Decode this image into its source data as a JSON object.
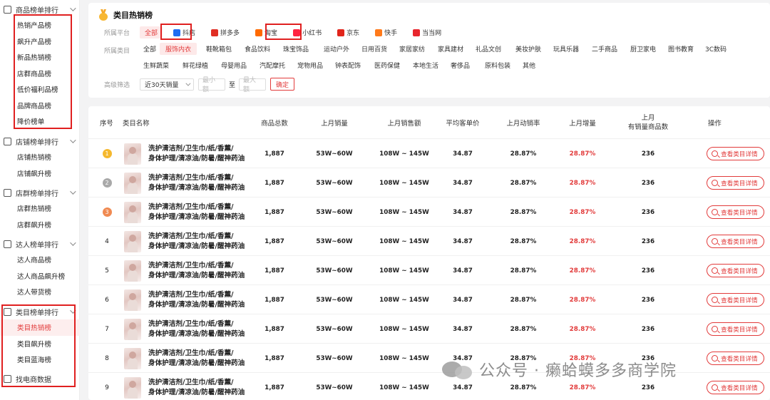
{
  "sidebar": {
    "groups": [
      {
        "title": "商品榜单排行",
        "items": [
          "热销产品榜",
          "飙升产品榜",
          "新品热销榜",
          "店群商品榜",
          "低价福利品榜",
          "品牌商品榜",
          "降价榜单"
        ]
      },
      {
        "title": "店铺榜单排行",
        "items": [
          "店铺热销榜",
          "店铺飙升榜"
        ]
      },
      {
        "title": "店群榜单排行",
        "items": [
          "店群热销榜",
          "店群飙升榜"
        ]
      },
      {
        "title": "达人榜单排行",
        "items": [
          "达人商品榜",
          "达人商品飙升榜",
          "达人带货榜"
        ]
      },
      {
        "title": "类目榜单排行",
        "items": [
          "类目热销榜",
          "类目飙升榜",
          "类目蓝海榜"
        ]
      }
    ],
    "extra": "找电商数据",
    "active_item": "类目热销榜"
  },
  "header": {
    "title": "类目热销榜"
  },
  "filters": {
    "platform_label": "所属平台",
    "platforms": [
      {
        "label": "全部",
        "selected": true,
        "color": ""
      },
      {
        "label": "抖店",
        "selected": false,
        "color": "#1f6df2"
      },
      {
        "label": "拼多多",
        "selected": false,
        "color": "#e02e24"
      },
      {
        "label": "淘宝",
        "selected": false,
        "color": "#ff6a00"
      },
      {
        "label": "小红书",
        "selected": false,
        "color": "#ff2442"
      },
      {
        "label": "京东",
        "selected": false,
        "color": "#e1251b"
      },
      {
        "label": "快手",
        "selected": false,
        "color": "#ff7a1a"
      },
      {
        "label": "当当网",
        "selected": false,
        "color": "#e8262d"
      }
    ],
    "category_label": "所属类目",
    "categories_row1": [
      "全部",
      "服饰内衣",
      "鞋靴箱包",
      "食品饮料",
      "珠宝饰品",
      "运动户外",
      "日用百货",
      "家居家纺",
      "家具建材",
      "礼品文创",
      "美妆护肤",
      "玩具乐器",
      "二手商品",
      "厨卫家电",
      "图书教育",
      "3C数码"
    ],
    "categories_row2": [
      "生鲜蔬菜",
      "鲜花绿植",
      "母婴用品",
      "汽配摩托",
      "宠物用品",
      "钟表配饰",
      "医药保健",
      "本地生活",
      "奢侈品",
      "原料包装",
      "其他"
    ],
    "selected_category": "服饰内衣",
    "advanced_label": "高级筛选",
    "period_value": "近30天销量",
    "min_placeholder": "最小额",
    "to_label": "至",
    "max_placeholder": "最大额",
    "confirm_label": "确定"
  },
  "table": {
    "headers": {
      "rank": "序号",
      "name": "类目名称",
      "total": "商品总数",
      "sales": "上月销量",
      "revenue": "上月销售额",
      "avg_price": "平均客单价",
      "move_rate": "上月动销率",
      "growth": "上月增量",
      "with_sales_line1": "上月",
      "with_sales_line2": "有销量商品数",
      "action": "操作"
    },
    "rows": [
      {
        "rank": "1",
        "name_line1": "洗护清洁剂/卫生巾/纸/香薰/",
        "name_line2": "身体护理/清凉油/防暑/醒神药油",
        "total": "1,887",
        "sales": "53W~60W",
        "revenue": "108W ~ 145W",
        "avg_price": "34.87",
        "move_rate": "28.87%",
        "growth": "28.87%",
        "with_sales": "236",
        "action": "查看类目详情"
      },
      {
        "rank": "2",
        "name_line1": "洗护清洁剂/卫生巾/纸/香薰/",
        "name_line2": "身体护理/清凉油/防暑/醒神药油",
        "total": "1,887",
        "sales": "53W~60W",
        "revenue": "108W ~ 145W",
        "avg_price": "34.87",
        "move_rate": "28.87%",
        "growth": "28.87%",
        "with_sales": "236",
        "action": "查看类目详情"
      },
      {
        "rank": "3",
        "name_line1": "洗护清洁剂/卫生巾/纸/香薰/",
        "name_line2": "身体护理/清凉油/防暑/醒神药油",
        "total": "1,887",
        "sales": "53W~60W",
        "revenue": "108W ~ 145W",
        "avg_price": "34.87",
        "move_rate": "28.87%",
        "growth": "28.87%",
        "with_sales": "236",
        "action": "查看类目详情"
      },
      {
        "rank": "4",
        "name_line1": "洗护清洁剂/卫生巾/纸/香薰/",
        "name_line2": "身体护理/清凉油/防暑/醒神药油",
        "total": "1,887",
        "sales": "53W~60W",
        "revenue": "108W ~ 145W",
        "avg_price": "34.87",
        "move_rate": "28.87%",
        "growth": "28.87%",
        "with_sales": "236",
        "action": "查看类目详情"
      },
      {
        "rank": "5",
        "name_line1": "洗护清洁剂/卫生巾/纸/香薰/",
        "name_line2": "身体护理/清凉油/防暑/醒神药油",
        "total": "1,887",
        "sales": "53W~60W",
        "revenue": "108W ~ 145W",
        "avg_price": "34.87",
        "move_rate": "28.87%",
        "growth": "28.87%",
        "with_sales": "236",
        "action": "查看类目详情"
      },
      {
        "rank": "6",
        "name_line1": "洗护清洁剂/卫生巾/纸/香薰/",
        "name_line2": "身体护理/清凉油/防暑/醒神药油",
        "total": "1,887",
        "sales": "53W~60W",
        "revenue": "108W ~ 145W",
        "avg_price": "34.87",
        "move_rate": "28.87%",
        "growth": "28.87%",
        "with_sales": "236",
        "action": "查看类目详情"
      },
      {
        "rank": "7",
        "name_line1": "洗护清洁剂/卫生巾/纸/香薰/",
        "name_line2": "身体护理/清凉油/防暑/醒神药油",
        "total": "1,887",
        "sales": "53W~60W",
        "revenue": "108W ~ 145W",
        "avg_price": "34.87",
        "move_rate": "28.87%",
        "growth": "28.87%",
        "with_sales": "236",
        "action": "查看类目详情"
      },
      {
        "rank": "8",
        "name_line1": "洗护清洁剂/卫生巾/纸/香薰/",
        "name_line2": "身体护理/清凉油/防暑/醒神药油",
        "total": "1,887",
        "sales": "53W~60W",
        "revenue": "108W ~ 145W",
        "avg_price": "34.87",
        "move_rate": "28.87%",
        "growth": "28.87%",
        "with_sales": "236",
        "action": "查看类目详情"
      },
      {
        "rank": "9",
        "name_line1": "洗护清洁剂/卫生巾/纸/香薰/",
        "name_line2": "身体护理/清凉油/防暑/醒神药油",
        "total": "1,887",
        "sales": "53W~60W",
        "revenue": "108W ~ 145W",
        "avg_price": "34.87",
        "move_rate": "28.87%",
        "growth": "28.87%",
        "with_sales": "236",
        "action": "查看类目详情"
      }
    ],
    "rank_colors": [
      "#f5b82e",
      "#a9a9a9",
      "#f08a52"
    ]
  },
  "watermark": {
    "text": "公众号 · 癞蛤蟆多多商学院"
  },
  "colors": {
    "accent": "#e23b3b",
    "highlight_box": "#e02020"
  }
}
